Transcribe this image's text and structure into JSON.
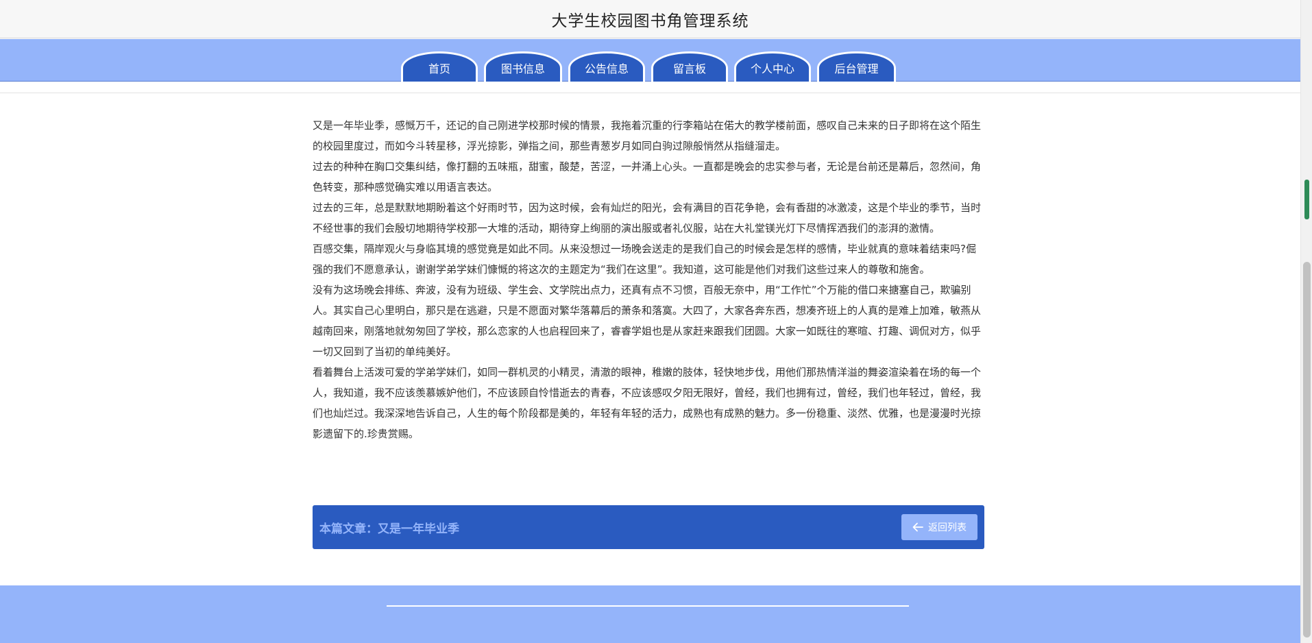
{
  "header": {
    "title": "大学生校园图书角管理系统"
  },
  "nav": {
    "tabs": [
      {
        "label": "首页"
      },
      {
        "label": "图书信息"
      },
      {
        "label": "公告信息"
      },
      {
        "label": "留言板"
      },
      {
        "label": "个人中心"
      },
      {
        "label": "后台管理"
      }
    ]
  },
  "article": {
    "paragraphs": [
      "又是一年毕业季，感慨万千，还记的自己刚进学校那时候的情景，我拖着沉重的行李箱站在偌大的教学楼前面，感叹自己未来的日子即将在这个陌生的校园里度过，而如今斗转星移，浮光掠影，弹指之间，那些青葱岁月如同白驹过隙般悄然从指缝溜走。",
      "过去的种种在胸口交集纠结，像打翻的五味瓶，甜蜜，酸楚，苦涩，一并涌上心头。一直都是晚会的忠实参与者，无论是台前还是幕后，忽然间，角色转变，那种感觉确实难以用语言表达。",
      "过去的三年，总是默默地期盼着这个好雨时节，因为这时候，会有灿烂的阳光，会有满目的百花争艳，会有香甜的冰激凌，这是个毕业的季节，当时不经世事的我们会殷切地期待学校那一大堆的活动，期待穿上绚丽的演出服或者礼仪服，站在大礼堂镁光灯下尽情挥洒我们的澎湃的激情。",
      "百感交集，隔岸观火与身临其境的感觉竟是如此不同。从来没想过一场晚会送走的是我们自己的时候会是怎样的感情，毕业就真的意味着结束吗?倔强的我们不愿意承认，谢谢学弟学妹们慷慨的将这次的主题定为“我们在这里”。我知道，这可能是他们对我们这些过来人的尊敬和施舍。",
      "没有为这场晚会排练、奔波，没有为班级、学生会、文学院出点力，还真有点不习惯，百般无奈中，用“工作忙”个万能的借口来搪塞自己，欺骗别人。其实自己心里明白，那只是在逃避，只是不愿面对繁华落幕后的萧条和落寞。大四了，大家各奔东西，想凑齐班上的人真的是难上加难，敏燕从越南回来，刚落地就匆匆回了学校，那么恋家的人也启程回来了，睿睿学姐也是从家赶来跟我们团圆。大家一如既往的寒暄、打趣、调侃对方，似乎一切又回到了当初的单纯美好。",
      "看着舞台上活泼可爱的学弟学妹们，如同一群机灵的小精灵，清澈的眼神，稚嫩的肢体，轻快地步伐，用他们那热情洋溢的舞姿渲染着在场的每一个人，我知道，我不应该羡慕嫉妒他们，不应该顾自怜惜逝去的青春，不应该感叹夕阳无限好，曾经，我们也拥有过，曾经，我们也年轻过，曾经，我们也灿烂过。我深深地告诉自己，人生的每个阶段都是美的，年轻有年轻的活力，成熟也有成熟的魅力。多一份稳重、淡然、优雅，也是漫漫时光掠影遗留下的.珍贵赏赐。"
    ],
    "caption": "本篇文章：又是一年毕业季",
    "back_label": "返回列表"
  },
  "colors": {
    "primary": "#2a5bc0",
    "light": "#94b4fa"
  }
}
